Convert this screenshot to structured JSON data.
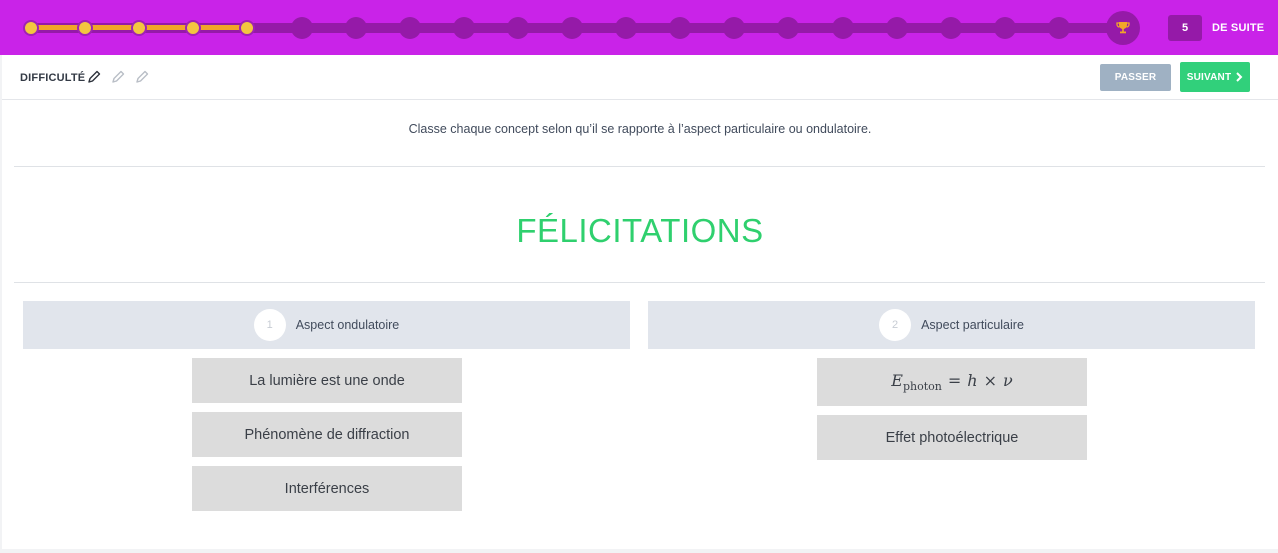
{
  "progress": {
    "total_steps": 20,
    "completed_steps": 5,
    "colors": {
      "bar": "#c923e8",
      "track": "#951aa8",
      "fill": "#f1a629",
      "done_dot": "#f3c640"
    }
  },
  "streak": {
    "count": "5",
    "label": "DE SUITE"
  },
  "toolbar": {
    "difficulty_label": "DIFFICULTÉ",
    "difficulty_level": 1,
    "difficulty_max": 3,
    "skip_label": "PASSER",
    "next_label": "SUIVANT"
  },
  "main": {
    "instruction": "Classe chaque concept selon qu’il se rapporte à l’aspect particulaire ou ondulatoire.",
    "result": "FÉLICITATIONS",
    "result_color": "#2fd06e",
    "categories": [
      {
        "number": "1",
        "title": "Aspect ondulatoire",
        "items": [
          "La lumière est une onde",
          "Phénomène de diffraction",
          "Interférences"
        ]
      },
      {
        "number": "2",
        "title": "Aspect particulaire",
        "items": [
          "E",
          "photon",
          "=",
          "h",
          "×",
          "ν",
          "Effet photoélectrique"
        ]
      }
    ]
  }
}
